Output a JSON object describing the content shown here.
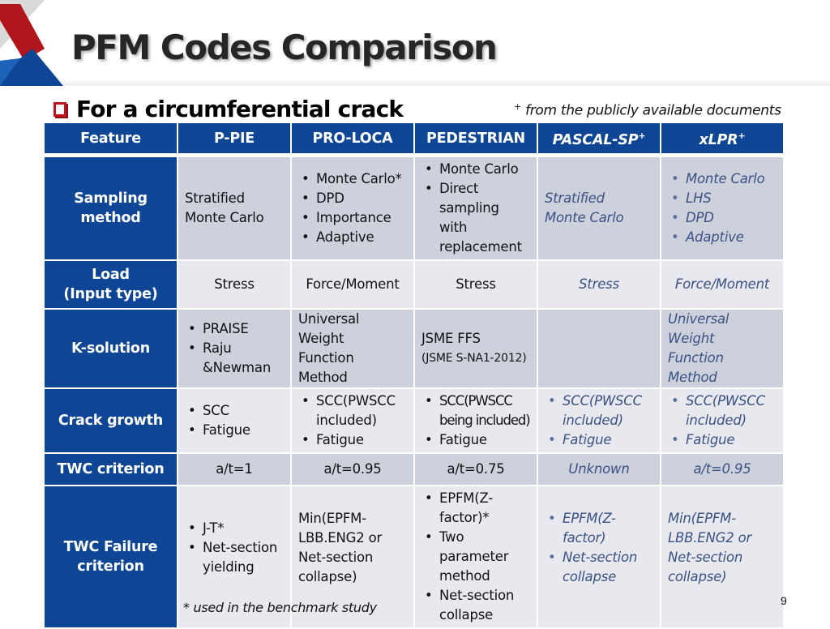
{
  "slide": {
    "title": "PFM Codes Comparison",
    "subtitle": "For a circumferential crack",
    "note_mark": "+",
    "note_text": " from the publicly available documents",
    "footnote": "* used in the benchmark study",
    "page_number": "9"
  },
  "colors": {
    "header_bg": "#0e4595",
    "row_dark": "#cdd1dc",
    "row_light": "#e8e9ee",
    "italic_text": "#3b5083",
    "checkbox": "#c0141c"
  },
  "table": {
    "headers": [
      {
        "label": "Feature",
        "plus": ""
      },
      {
        "label": "P-PIE",
        "plus": ""
      },
      {
        "label": "PRO-LOCA",
        "plus": ""
      },
      {
        "label": "PEDESTRIAN",
        "plus": ""
      },
      {
        "label": "PASCAL-SP",
        "plus": "+"
      },
      {
        "label": "xLPR",
        "plus": "+"
      }
    ],
    "rows": {
      "sampling": {
        "feature": [
          "Sampling",
          "method"
        ],
        "ppie": [
          "Stratified",
          "Monte Carlo"
        ],
        "proloca": [
          "Monte Carlo*",
          "DPD",
          "Importance",
          "Adaptive"
        ],
        "pedestrian": [
          "Monte Carlo",
          "Direct sampling with replacement"
        ],
        "pascal": [
          "Stratified",
          "Monte Carlo"
        ],
        "xlpr": [
          "Monte Carlo",
          "LHS",
          "DPD",
          "Adaptive"
        ]
      },
      "load": {
        "feature": [
          "Load",
          "(Input type)"
        ],
        "ppie": "Stress",
        "proloca": "Force/Moment",
        "pedestrian": "Stress",
        "pascal": "Stress",
        "xlpr": "Force/Moment"
      },
      "ksolution": {
        "feature": "K-solution",
        "ppie": [
          "PRAISE",
          "Raju &Newman"
        ],
        "proloca": [
          "Universal Weight",
          "Function Method"
        ],
        "pedestrian": [
          "JSME FFS",
          "(JSME S-NA1-2012)"
        ],
        "pascal": "",
        "xlpr": [
          "Universal Weight",
          "Function Method"
        ]
      },
      "crack": {
        "feature": "Crack growth",
        "ppie": [
          "SCC",
          "Fatigue"
        ],
        "proloca": [
          "SCC(PWSCC included)",
          "Fatigue"
        ],
        "pedestrian": [
          "SCC(PWSCC being included)",
          "Fatigue"
        ],
        "pascal": [
          "SCC(PWSCC included)",
          "Fatigue"
        ],
        "xlpr": [
          "SCC(PWSCC included)",
          "Fatigue"
        ]
      },
      "twc": {
        "feature": "TWC criterion",
        "ppie": "a/t=1",
        "proloca": "a/t=0.95",
        "pedestrian": "a/t=0.75",
        "pascal": "Unknown",
        "xlpr": "a/t=0.95"
      },
      "failure": {
        "feature": [
          "TWC Failure",
          "criterion"
        ],
        "ppie": [
          "J-T*",
          "Net-section yielding"
        ],
        "proloca": [
          "Min(EPFM-",
          "LBB.ENG2 or",
          "Net-section",
          "collapse)"
        ],
        "pedestrian": [
          "EPFM(Z-factor)*",
          "Two parameter method",
          "Net-section collapse"
        ],
        "pascal": [
          "EPFM(Z-factor)",
          "Net-section collapse"
        ],
        "xlpr": [
          "Min(EPFM-",
          "LBB.ENG2 or",
          "Net-section",
          "collapse)"
        ]
      }
    }
  }
}
